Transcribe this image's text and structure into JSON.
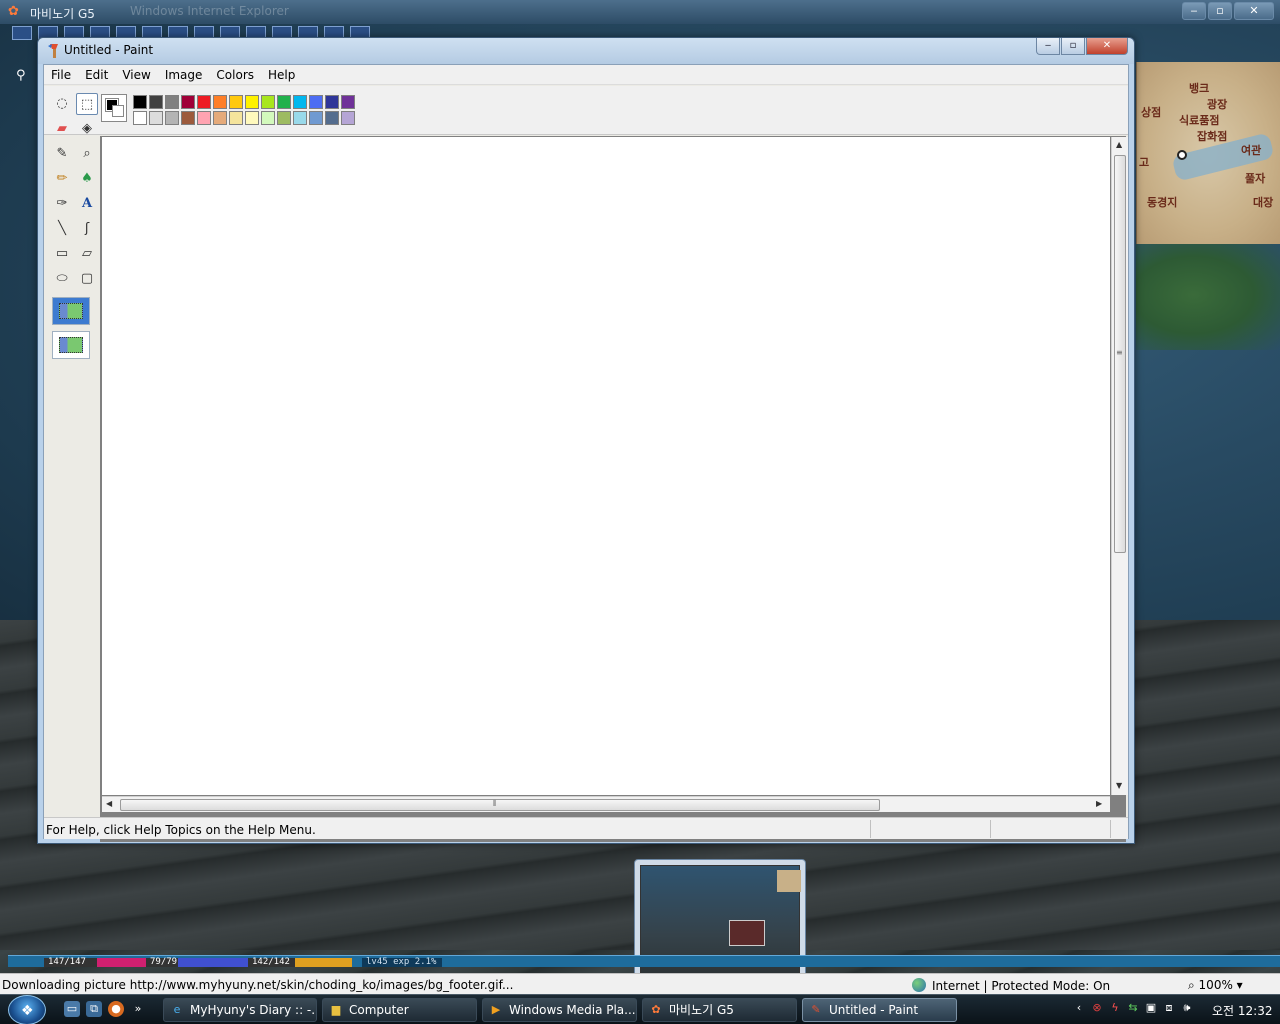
{
  "ie_window": {
    "title": "마비노기 G5",
    "faint_title": "Windows Internet Explorer",
    "status_text": "Downloading picture http://www.myhyuny.net/skin/choding_ko/images/bg_footer.gif...",
    "zone": "Internet | Protected Mode: On",
    "zoom": "100%"
  },
  "minimap": {
    "labels": [
      "뱅크",
      "광장",
      "식료품점",
      "잡화점",
      "여관",
      "동경지",
      "풀자",
      "대장",
      "상점",
      "고"
    ]
  },
  "paint": {
    "title": "Untitled - Paint",
    "menu": [
      "File",
      "Edit",
      "View",
      "Image",
      "Colors",
      "Help"
    ],
    "status": "For Help, click Help Topics on the Help Menu.",
    "foreground_color": "#000000",
    "background_color": "#ffffff",
    "palette": [
      "#000000",
      "#404040",
      "#808080",
      "#a00038",
      "#ed1c24",
      "#ff7f27",
      "#ffc90e",
      "#fff200",
      "#a8e61d",
      "#22b14c",
      "#00b7ef",
      "#4d6df3",
      "#2f3699",
      "#6f3198",
      "#ffffff",
      "#dcdcdc",
      "#b4b4b4",
      "#9c5a3c",
      "#ffa3b1",
      "#e5aa7a",
      "#f5e49c",
      "#fff9bd",
      "#d3f9bc",
      "#9dbb61",
      "#99d9ea",
      "#709ad1",
      "#546d8e",
      "#b5a5d5"
    ],
    "tools": [
      {
        "name": "free-form-select-icon",
        "glyph": "◌"
      },
      {
        "name": "select-icon",
        "glyph": "⬚"
      },
      {
        "name": "eraser-icon",
        "glyph": "▰"
      },
      {
        "name": "fill-icon",
        "glyph": "◈"
      },
      {
        "name": "pick-color-icon",
        "glyph": "✎"
      },
      {
        "name": "magnifier-icon",
        "glyph": "⌕"
      },
      {
        "name": "pencil-icon",
        "glyph": "✏"
      },
      {
        "name": "brush-icon",
        "glyph": "♠"
      },
      {
        "name": "airbrush-icon",
        "glyph": "✑"
      },
      {
        "name": "text-icon",
        "glyph": "A"
      },
      {
        "name": "line-icon",
        "glyph": "╲"
      },
      {
        "name": "curve-icon",
        "glyph": "ʃ"
      },
      {
        "name": "rectangle-icon",
        "glyph": "▭"
      },
      {
        "name": "polygon-icon",
        "glyph": "▱"
      },
      {
        "name": "ellipse-icon",
        "glyph": "⬭"
      },
      {
        "name": "rounded-rectangle-icon",
        "glyph": "▢"
      }
    ]
  },
  "hud": {
    "hp": "147/147",
    "mp": "79/79",
    "sp": "142/142",
    "level": "lv45 exp 2.1%"
  },
  "taskbar": {
    "items": [
      {
        "label": "MyHyuny's Diary :: -...",
        "icon": "ie-icon",
        "active": false
      },
      {
        "label": "Computer",
        "icon": "folder-icon",
        "active": false
      },
      {
        "label": "Windows Media Pla...",
        "icon": "media-player-icon",
        "active": false
      },
      {
        "label": "마비노기 G5",
        "icon": "mabinogi-icon",
        "active": false
      },
      {
        "label": "Untitled - Paint",
        "icon": "paint-icon",
        "active": true
      }
    ],
    "clock": "오전 12:32"
  }
}
